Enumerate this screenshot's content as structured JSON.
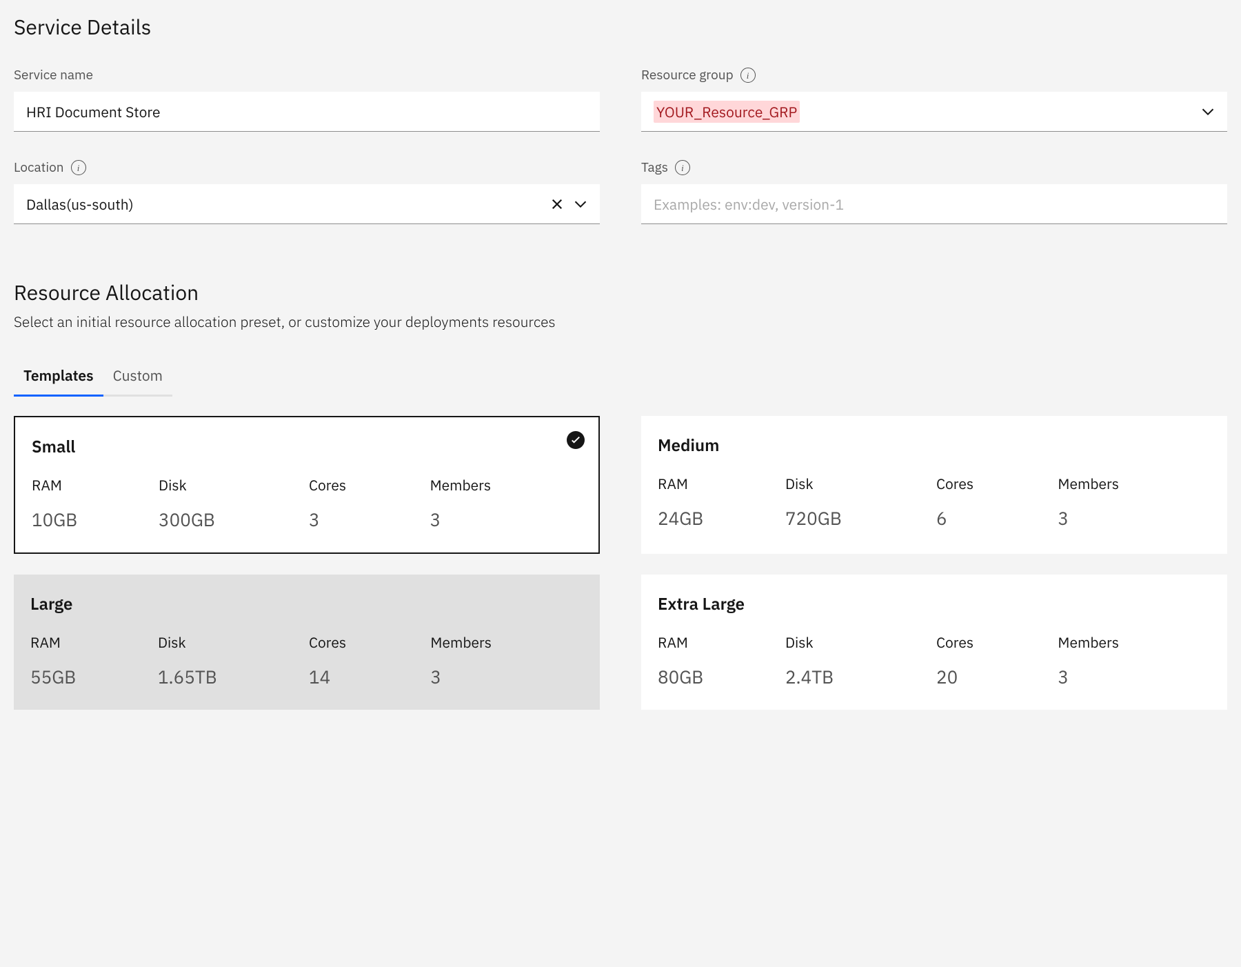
{
  "service_details": {
    "title": "Service Details",
    "service_name": {
      "label": "Service name",
      "value": "HRI Document Store"
    },
    "resource_group": {
      "label": "Resource group",
      "value": "YOUR_Resource_GRP"
    },
    "location": {
      "label": "Location",
      "value": "Dallas(us-south)"
    },
    "tags": {
      "label": "Tags",
      "placeholder": "Examples: env:dev, version-1"
    }
  },
  "resource_allocation": {
    "title": "Resource Allocation",
    "description": "Select an initial resource allocation preset, or customize your deployments resources",
    "tabs": [
      {
        "label": "Templates",
        "active": true
      },
      {
        "label": "Custom",
        "active": false
      }
    ],
    "spec_headers": {
      "ram": "RAM",
      "disk": "Disk",
      "cores": "Cores",
      "members": "Members"
    },
    "templates": [
      {
        "name": "Small",
        "ram": "10GB",
        "disk": "300GB",
        "cores": "3",
        "members": "3",
        "selected": true
      },
      {
        "name": "Medium",
        "ram": "24GB",
        "disk": "720GB",
        "cores": "6",
        "members": "3",
        "selected": false
      },
      {
        "name": "Large",
        "ram": "55GB",
        "disk": "1.65TB",
        "cores": "14",
        "members": "3",
        "selected": false
      },
      {
        "name": "Extra Large",
        "ram": "80GB",
        "disk": "2.4TB",
        "cores": "20",
        "members": "3",
        "selected": false
      }
    ]
  }
}
